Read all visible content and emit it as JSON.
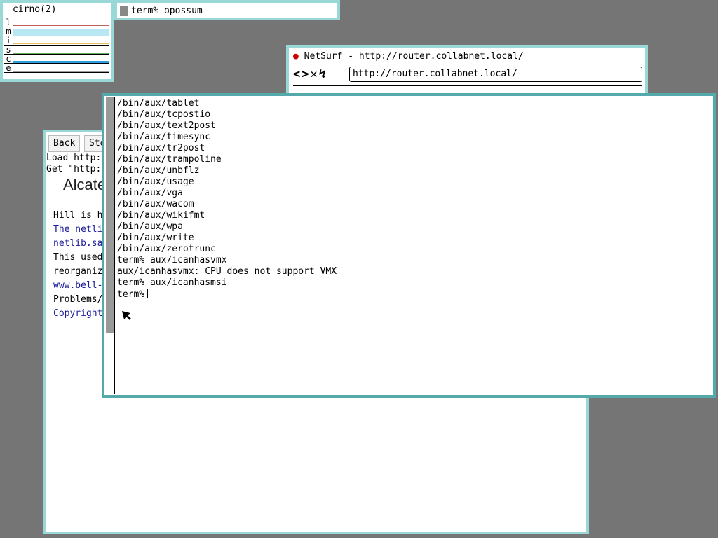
{
  "stats": {
    "title": "cirno(2)",
    "labels": [
      "l",
      "m",
      "i",
      "s",
      "c",
      "e"
    ],
    "colors": [
      "#c06060",
      "#7fd4e8",
      "#e0c060",
      "#60b060",
      "#2e9be0",
      "#999999"
    ]
  },
  "term_label": {
    "text": "term% opossum"
  },
  "netsurf": {
    "title": "NetSurf - http://router.collabnet.local/",
    "nav_icons": "<>✕↯",
    "url": "http://router.collabnet.local/"
  },
  "browser": {
    "back": "Back",
    "stop": "Sto",
    "status": [
      "Load http:",
      "Get \"http:"
    ],
    "logo": "Alcate",
    "lines": [
      "Hill is h",
      "The netli",
      "netlib.sa",
      "This used",
      "reorganiz",
      "www.bell-",
      "Problems/",
      "Copyright"
    ]
  },
  "terminal": {
    "lines": [
      "/bin/aux/tablet",
      "/bin/aux/tcpostio",
      "/bin/aux/text2post",
      "/bin/aux/timesync",
      "/bin/aux/tr2post",
      "/bin/aux/trampoline",
      "/bin/aux/unbflz",
      "/bin/aux/usage",
      "/bin/aux/vga",
      "/bin/aux/wacom",
      "/bin/aux/wikifmt",
      "/bin/aux/wpa",
      "/bin/aux/write",
      "/bin/aux/zerotrunc",
      "term% aux/icanhasvmx",
      "aux/icanhasvmx: CPU does not support VMX",
      "term% aux/icanhasmsi"
    ],
    "prompt": "term%"
  }
}
